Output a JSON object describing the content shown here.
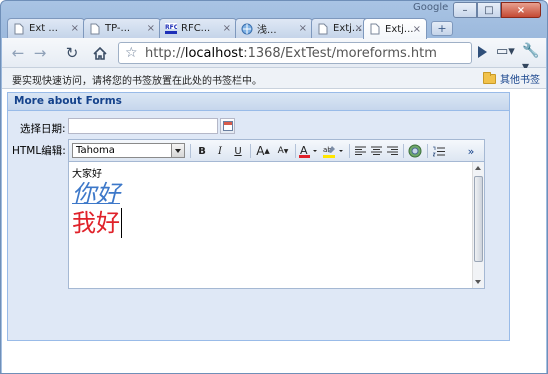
{
  "browser": {
    "brand_label": "Google",
    "window_buttons": {
      "minimize": "–",
      "maximize": "□",
      "close": "×"
    },
    "tabs": [
      {
        "label": "Ext ...",
        "icon": "page-icon",
        "active": false
      },
      {
        "label": "TP-...",
        "icon": "page-icon",
        "active": false
      },
      {
        "label": "RFC...",
        "icon": "rfc-icon",
        "active": false
      },
      {
        "label": "浅...",
        "icon": "globe-icon",
        "active": false
      },
      {
        "label": "Extj...",
        "icon": "page-icon",
        "active": false
      },
      {
        "label": "Extj...",
        "icon": "page-icon",
        "active": true
      }
    ],
    "new_tab": "+",
    "url": {
      "scheme": "http://",
      "host": "localhost",
      "rest": ":1368/ExtTest/moreforms.htm"
    },
    "bookmarks_message": "要实现快速访问，请将您的书签放置在此处的书签栏中。",
    "other_bookmarks": "其他书签"
  },
  "form": {
    "panel_title": "More about Forms",
    "date_label": "选择日期:",
    "date_value": "",
    "html_label": "HTML编辑:",
    "font_family": "Tahoma",
    "toolbar": {
      "bold": "B",
      "italic": "I",
      "underline": "U",
      "grow": "A",
      "shrink": "A"
    },
    "content": {
      "line1": "大家好",
      "line2": "你好",
      "line3": "我好"
    }
  },
  "colors": {
    "panel_header_text": "#15428b",
    "line2": "#3d78c9",
    "line3": "#e0222a"
  }
}
